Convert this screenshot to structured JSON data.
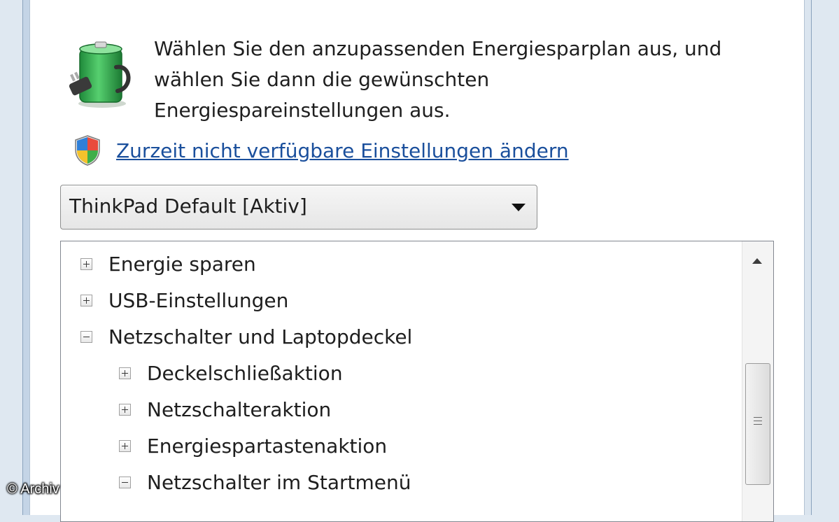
{
  "header": {
    "description_lines": [
      "Wählen Sie den anzupassenden Energiesparplan aus, und",
      "wählen Sie dann die gewünschten",
      "Energiespareinstellungen aus."
    ],
    "icon": "power-battery-icon"
  },
  "admin_link": {
    "icon": "uac-shield-icon",
    "label": "Zurzeit nicht verfügbare Einstellungen ändern"
  },
  "plan_select": {
    "selected": "ThinkPad Default [Aktiv]"
  },
  "tree": {
    "items": [
      {
        "label": "Energie sparen",
        "expanded": false,
        "level": 0
      },
      {
        "label": "USB-Einstellungen",
        "expanded": false,
        "level": 0
      },
      {
        "label": "Netzschalter und Laptopdeckel",
        "expanded": true,
        "level": 0
      },
      {
        "label": "Deckelschließaktion",
        "expanded": false,
        "level": 1
      },
      {
        "label": "Netzschalteraktion",
        "expanded": false,
        "level": 1
      },
      {
        "label": "Energiespartastenaktion",
        "expanded": false,
        "level": 1
      },
      {
        "label": "Netzschalter im Startmenü",
        "expanded": true,
        "level": 1
      }
    ]
  },
  "watermark": "© Archiv",
  "colors": {
    "link": "#1a4f9c",
    "battery_green": "#2fa84f",
    "text": "#1e1e1e"
  }
}
